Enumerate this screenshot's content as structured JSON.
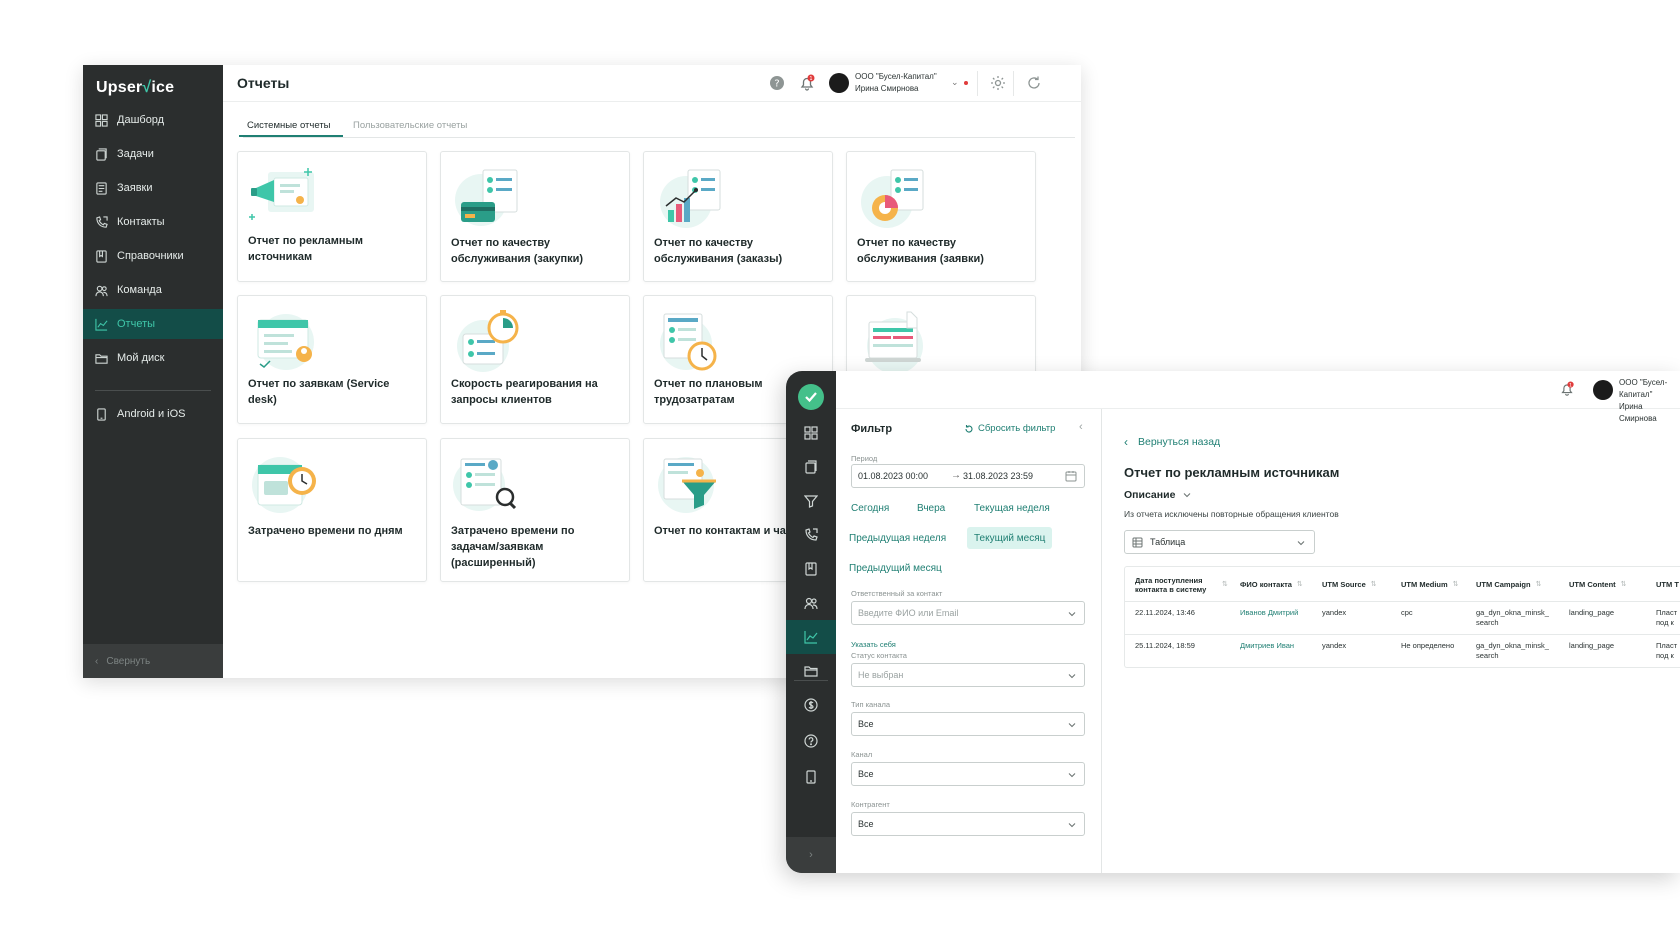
{
  "colors": {
    "accent": "#1f7f73",
    "sidebar": "#2b2e2e",
    "active_nav": "#134d48",
    "teal_light": "#3fc6a9",
    "notification": "#e03c3c"
  },
  "window_main": {
    "logo": {
      "pre": "Upser",
      "mark": "√",
      "post": "ice"
    },
    "sidebar": {
      "items": [
        {
          "label": "Дашборд",
          "icon": "dashboard-icon"
        },
        {
          "label": "Задачи",
          "icon": "tasks-icon"
        },
        {
          "label": "Заявки",
          "icon": "requests-icon"
        },
        {
          "label": "Контакты",
          "icon": "contacts-icon"
        },
        {
          "label": "Справочники",
          "icon": "book-icon"
        },
        {
          "label": "Команда",
          "icon": "team-icon"
        },
        {
          "label": "Отчеты",
          "icon": "chart-icon",
          "active": true
        },
        {
          "label": "Мой диск",
          "icon": "folder-icon"
        },
        {
          "label": "Android и iOS",
          "icon": "phone-icon"
        }
      ],
      "collapse_label": "Свернуть"
    },
    "header": {
      "title": "Отчеты",
      "notifications_count": "1",
      "org_name": "ООО \"Бусел-Капитал\"",
      "user_name": "Ирина Смирнова"
    },
    "tabs": [
      {
        "label": "Системные отчеты",
        "active": true
      },
      {
        "label": "Пользовательские отчеты",
        "active": false
      }
    ],
    "cards": [
      {
        "title": "Отчет по рекламным источникам",
        "icon": "megaphone-illustration"
      },
      {
        "title": "Отчет по качеству обслуживания (закупки)",
        "icon": "card-payment-illustration"
      },
      {
        "title": "Отчет по качеству обслуживания (заказы)",
        "icon": "growth-chart-illustration"
      },
      {
        "title": "Отчет по качеству обслуживания (заявки)",
        "icon": "pie-chart-illustration"
      },
      {
        "title": "Отчет по заявкам (Service desk)",
        "icon": "calendar-checklist-illustration"
      },
      {
        "title": "Скорость реагирования на запросы клиентов",
        "icon": "stopwatch-illustration"
      },
      {
        "title": "Отчет по плановым трудозатратам",
        "icon": "clock-checklist-illustration"
      },
      {
        "title": "",
        "icon": "laptop-report-illustration"
      },
      {
        "title": "Затрачено времени по дням",
        "icon": "calendar-clock-illustration"
      },
      {
        "title": "Затрачено времени по задачам/заявкам (расширенный)",
        "icon": "magnifier-illustration"
      },
      {
        "title": "Отчет по контактам и чатам",
        "icon": "funnel-illustration"
      }
    ]
  },
  "window_report": {
    "header": {
      "notifications_count": "1",
      "org_name": "ООО \"Бусел-Капитал\"",
      "user_name": "Ирина Смирнова"
    },
    "sidebar_icons": [
      "dashboard-icon",
      "tasks-icon",
      "requests-icon",
      "contacts-icon",
      "book-icon",
      "team-icon",
      "chart-icon",
      "folder-icon",
      "dollar-icon",
      "help-icon",
      "phone-icon"
    ],
    "filter": {
      "title": "Фильтр",
      "reset_label": "Сбросить фильтр",
      "period_label": "Период",
      "period_start": "01.08.2023 00:00",
      "period_arrow": "→",
      "period_end": "31.08.2023 23:59",
      "quick_periods": [
        {
          "label": "Сегодня",
          "active": false
        },
        {
          "label": "Вчера",
          "active": false
        },
        {
          "label": "Текущая неделя",
          "active": false
        },
        {
          "label": "Предыдущая неделя",
          "active": false
        },
        {
          "label": "Текущий месяц",
          "active": true
        },
        {
          "label": "Предыдущий месяц",
          "active": false
        }
      ],
      "responsible_label": "Ответственный за контакт",
      "responsible_placeholder": "Введите ФИО или Email",
      "set_me_label": "Указать себя",
      "status_label": "Статус контакта",
      "status_value": "Не выбран",
      "channel_type_label": "Тип канала",
      "channel_type_value": "Все",
      "channel_label": "Канал",
      "channel_value": "Все",
      "counterparty_label": "Контрагент",
      "counterparty_value": "Все"
    },
    "report": {
      "back_label": "Вернуться назад",
      "title": "Отчет по рекламным источникам",
      "description_label": "Описание",
      "description_text": "Из отчета исключены повторные обращения клиентов",
      "view_select": "Таблица",
      "columns": [
        "Дата поступления контакта в систему",
        "ФИО контакта",
        "UTM Source",
        "UTM Medium",
        "UTM Campaign",
        "UTM Content",
        "UTM T"
      ],
      "rows": [
        {
          "date": "22.11.2024, 13:46",
          "name": "Иванов Дмитрий",
          "source": "yandex",
          "medium": "cpc",
          "campaign": "ga_dyn_okna_minsk_ search",
          "content": "landing_page",
          "term": "Пласт под к"
        },
        {
          "date": "25.11.2024, 18:59",
          "name": "Дмитриев Иван",
          "source": "yandex",
          "medium": "Не определено",
          "campaign": "ga_dyn_okna_minsk_ search",
          "content": "landing_page",
          "term": "Пласт под к"
        }
      ]
    }
  }
}
